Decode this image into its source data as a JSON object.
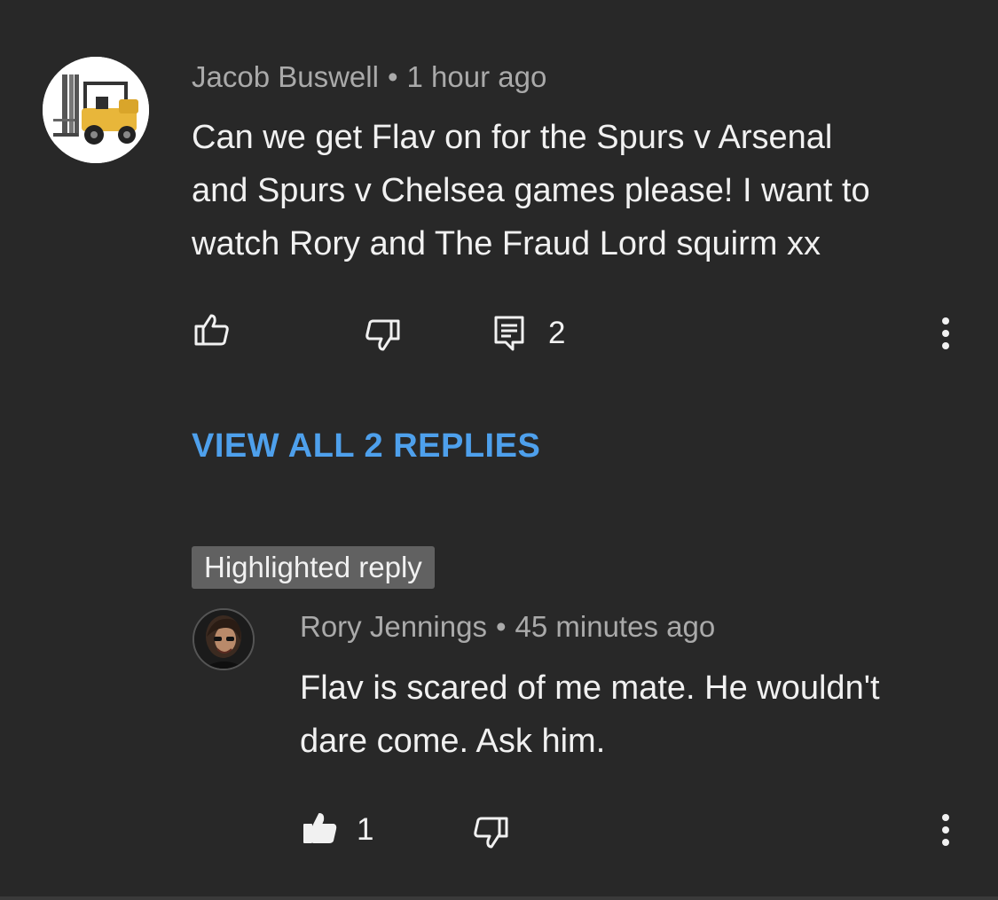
{
  "comment": {
    "author": "Jacob Buswell",
    "separator": "•",
    "time": "1 hour ago",
    "text": "Can we get Flav on for the Spurs v Arsenal\nand Spurs v Chelsea games please! I want to\nwatch Rory and The Fraud Lord squirm xx",
    "avatar_icon": "forklift-avatar",
    "actions": {
      "like_icon": "thumbs-up-outline-icon",
      "dislike_icon": "thumbs-down-outline-icon",
      "comments_icon": "comment-icon",
      "comment_count": "2",
      "more_icon": "more-vertical-icon"
    }
  },
  "view_replies_label": "VIEW ALL 2 REPLIES",
  "highlighted_badge": "Highlighted reply",
  "reply": {
    "author": "Rory Jennings",
    "separator": "•",
    "time": "45 minutes ago",
    "text": "Flav is scared of me mate. He wouldn't\ndare come. Ask him.",
    "avatar_icon": "person-photo-avatar",
    "actions": {
      "like_icon": "thumbs-up-filled-icon",
      "like_count": "1",
      "dislike_icon": "thumbs-down-outline-icon",
      "more_icon": "more-vertical-icon"
    }
  },
  "colors": {
    "background": "#282828",
    "meta_text": "#aaaaaa",
    "body_text": "#f1f1f1",
    "link": "#4ea0ec",
    "badge_bg": "#616161"
  }
}
